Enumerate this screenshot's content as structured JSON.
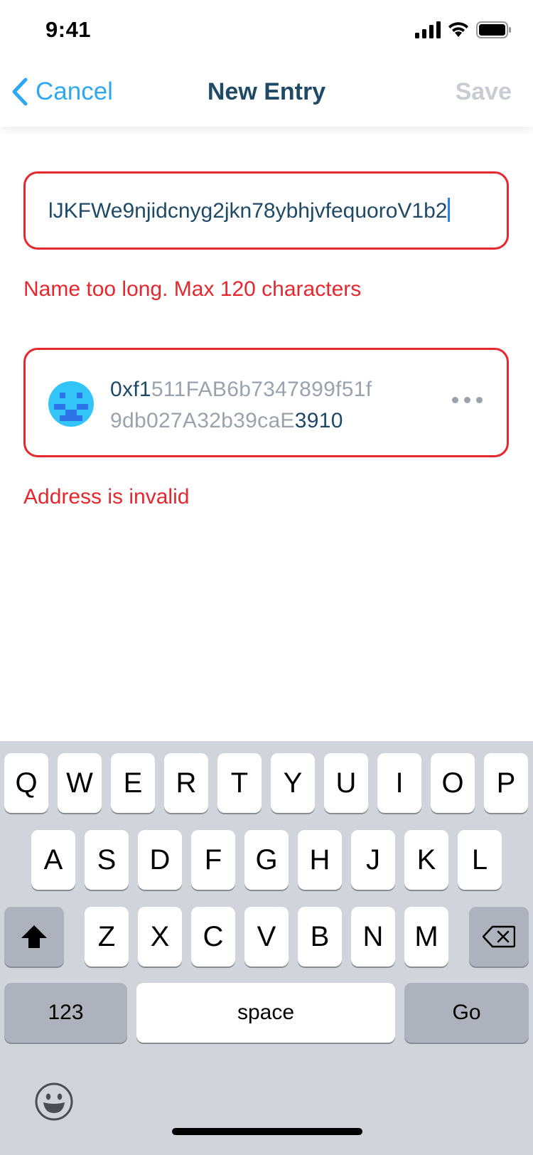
{
  "status_bar": {
    "time": "9:41"
  },
  "nav": {
    "back_label": "Cancel",
    "title": "New Entry",
    "save_label": "Save",
    "save_color": "#c9cdd3",
    "accent": "#2ea8f0"
  },
  "form": {
    "name_value": "lJKFWe9njidcnyg2jkn78ybhjvfequoroV1b2",
    "name_error": "Name too long. Max 120 characters",
    "address": {
      "prefix": "0xf1",
      "middle_line1": "511FAB6b7347899f51f",
      "middle_line2": "9db027A32b39caE",
      "suffix": "3910"
    },
    "address_error": "Address is invalid",
    "error_color": "#e4282e"
  },
  "keyboard": {
    "row1": [
      "Q",
      "W",
      "E",
      "R",
      "T",
      "Y",
      "U",
      "I",
      "O",
      "P"
    ],
    "row2": [
      "A",
      "S",
      "D",
      "F",
      "G",
      "H",
      "J",
      "K",
      "L"
    ],
    "row3": [
      "Z",
      "X",
      "C",
      "V",
      "B",
      "N",
      "M"
    ],
    "numbers_label": "123",
    "space_label": "space",
    "go_label": "Go",
    "icons": [
      "shift-icon",
      "backspace-icon",
      "emoji-icon"
    ]
  }
}
